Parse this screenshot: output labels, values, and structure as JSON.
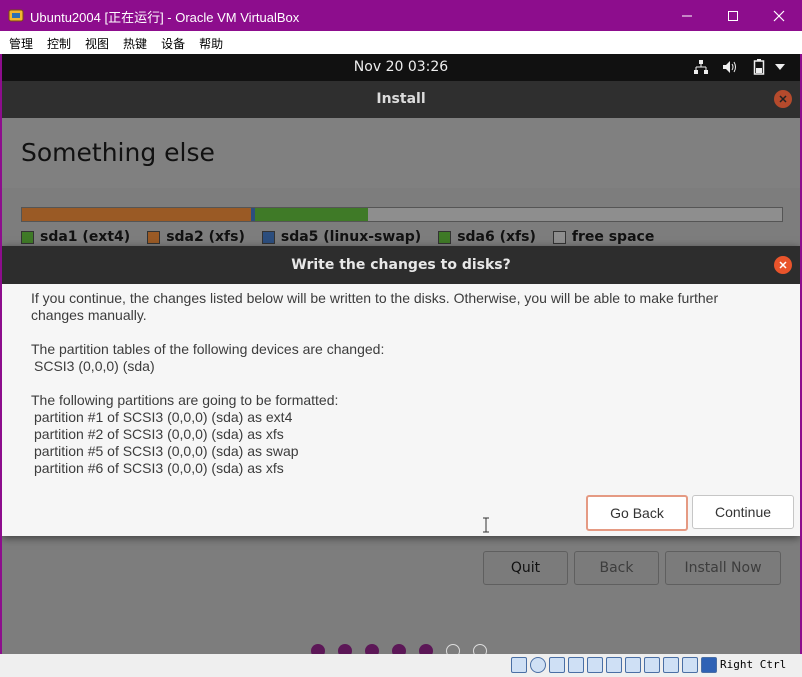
{
  "window": {
    "title": "Ubuntu2004 [正在运行] - Oracle VM VirtualBox",
    "controls": [
      "minimize",
      "maximize",
      "close"
    ]
  },
  "menu": [
    "管理",
    "控制",
    "视图",
    "热键",
    "设备",
    "帮助"
  ],
  "topbar": {
    "clock": "Nov 20  03:26",
    "icons": [
      "network-icon",
      "volume-icon",
      "battery-icon",
      "dropdown-arrow-icon"
    ]
  },
  "installer": {
    "title": "Install",
    "page_title": "Something else",
    "partitions": [
      {
        "label": "sda1 (ext4)",
        "color": "#4a8a2a",
        "fraction": 0.0
      },
      {
        "label": "sda2 (xfs)",
        "color": "#b15d1d",
        "fraction": 0.3
      },
      {
        "label": "sda5 (linux-swap)",
        "color": "#2c5aa0",
        "fraction": 0.005
      },
      {
        "label": "sda6 (xfs)",
        "color": "#4a8a2a",
        "fraction": 0.15
      },
      {
        "label": "free space",
        "color": "#9a9a9a",
        "fraction": 0.545
      }
    ],
    "buttons": {
      "quit": "Quit",
      "back": "Back",
      "install_now": "Install Now"
    },
    "progress_steps": {
      "completed": 5,
      "total": 7
    }
  },
  "dialog": {
    "title": "Write the changes to disks?",
    "intro": "If you continue, the changes listed below will be written to the disks. Otherwise, you will be able to make further",
    "intro_cont": "changes manually.",
    "tables_heading": "The partition tables of the following devices are changed:",
    "tables_device": "SCSI3 (0,0,0) (sda)",
    "format_heading": "The following partitions are going to be formatted:",
    "format_list": [
      "partition #1 of SCSI3 (0,0,0) (sda) as ext4",
      "partition #2 of SCSI3 (0,0,0) (sda) as xfs",
      "partition #5 of SCSI3 (0,0,0) (sda) as swap",
      "partition #6 of SCSI3 (0,0,0) (sda) as xfs"
    ],
    "go_back": "Go Back",
    "continue": "Continue"
  },
  "statusbar": {
    "host_key": "Right Ctrl"
  },
  "colors": {
    "window_frame": "#8d0d8d",
    "accent_orange": "#e9542b",
    "ubuntu_purple": "#5c1757"
  }
}
